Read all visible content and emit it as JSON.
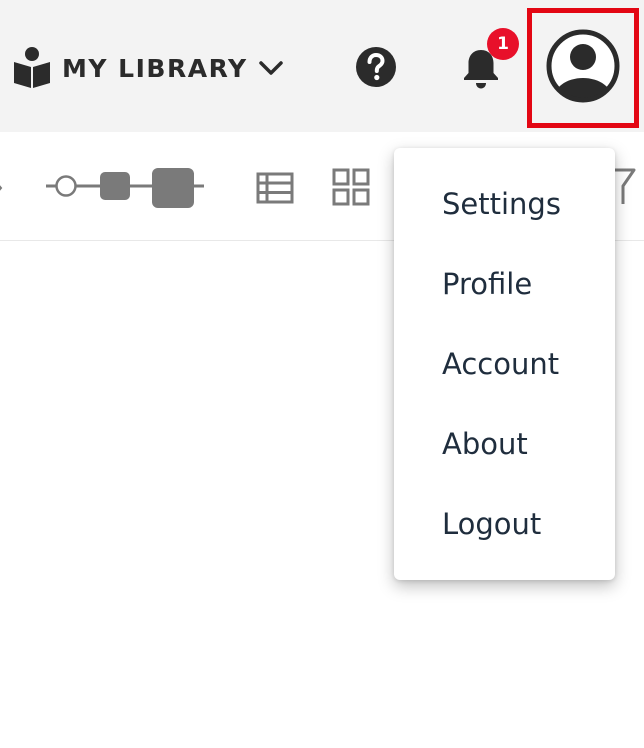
{
  "header": {
    "library_label": "MY LIBRARY",
    "library_icon": "book-reader-icon",
    "library_chevron": "chevron-down-icon",
    "help_icon": "help-circle-icon",
    "notifications_icon": "bell-icon",
    "notifications_count": "1",
    "account_icon": "user-circle-icon"
  },
  "toolbar": {
    "size_slider_icon": "thumbnail-size-slider-icon",
    "list_view_icon": "list-view-icon",
    "grid_view_icon": "grid-view-icon",
    "filter_icon": "filter-icon"
  },
  "account_menu": {
    "items": [
      {
        "label": "Settings"
      },
      {
        "label": "Profile"
      },
      {
        "label": "Account"
      },
      {
        "label": "About"
      },
      {
        "label": "Logout"
      }
    ]
  },
  "colors": {
    "header_bg": "#f3f3f3",
    "badge": "#e8102a",
    "highlight_box": "#e30613",
    "menu_text": "#1f2d3d",
    "icon_dark": "#2b2b2b",
    "icon_gray": "#7a7a7a"
  }
}
